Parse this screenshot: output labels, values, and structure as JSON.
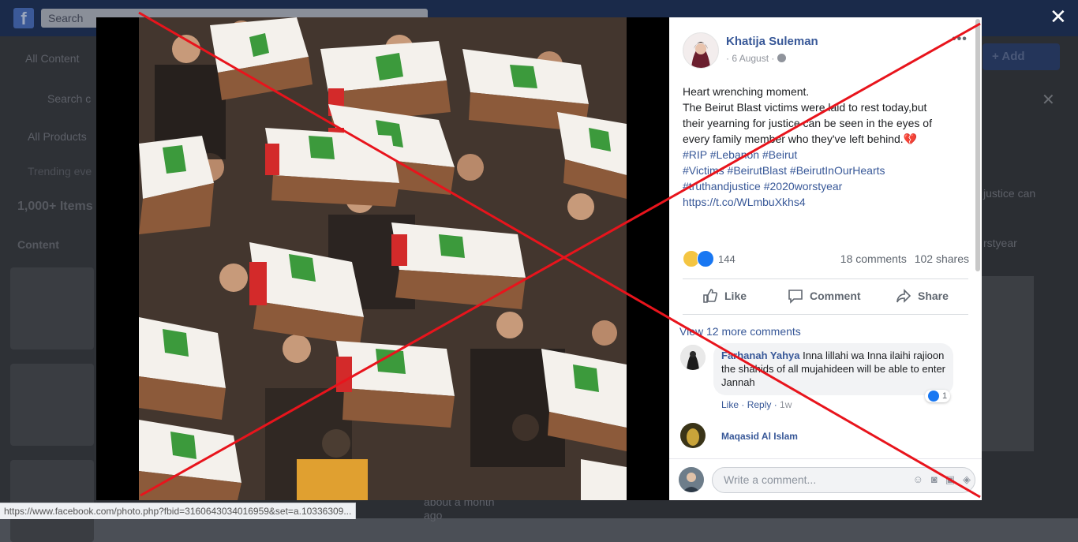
{
  "background": {
    "search_placeholder": "Search",
    "sidebar": {
      "all_content": "All Content",
      "search": "Search c",
      "all_products": "All Products",
      "trending": "Trending eve",
      "items_count": "1,000+ Items",
      "content": "Content"
    },
    "add_button": "+ Add",
    "right_fragments": [
      "justice can",
      "rstyear"
    ],
    "bottom_fragments": [
      "about a month",
      "ago"
    ]
  },
  "status_url": "https://www.facebook.com/photo.php?fbid=3160643034016959&set=a.10336309...",
  "post": {
    "author": "Khatija Suleman",
    "date": "6 August",
    "more": "•••",
    "lines": [
      "Heart wrenching moment.",
      "The Beirut Blast victims were laid to rest today,but",
      "their yearning for justice can be seen in the eyes of",
      "every family member who they've left behind.💔"
    ],
    "hashtags": [
      "#RIP #Lebanon #Beirut",
      "#Victims #BeirutBlast #BeirutInOurHearts",
      "#truthandjustice #2020worstyear"
    ],
    "url": "https://t.co/WLmbuXkhs4",
    "reaction_count": "144",
    "comments_count": "18 comments",
    "shares_count": "102 shares",
    "actions": {
      "like": "Like",
      "comment": "Comment",
      "share": "Share"
    }
  },
  "comments": {
    "view_more": "View 12 more comments",
    "first": {
      "name": "Farhanah Yahya",
      "text": "Inna lillahi wa Inna ilaihi rajioon the shahids of all mujahideen will be able to enter Jannah",
      "likes": "1",
      "like_label": "Like",
      "reply_label": "Reply",
      "time": "1w"
    },
    "second_name": "Maqasid Al Islam",
    "write_placeholder": "Write a comment..."
  },
  "colors": {
    "facebook_blue": "#385898",
    "cross_red": "#e8141c"
  }
}
